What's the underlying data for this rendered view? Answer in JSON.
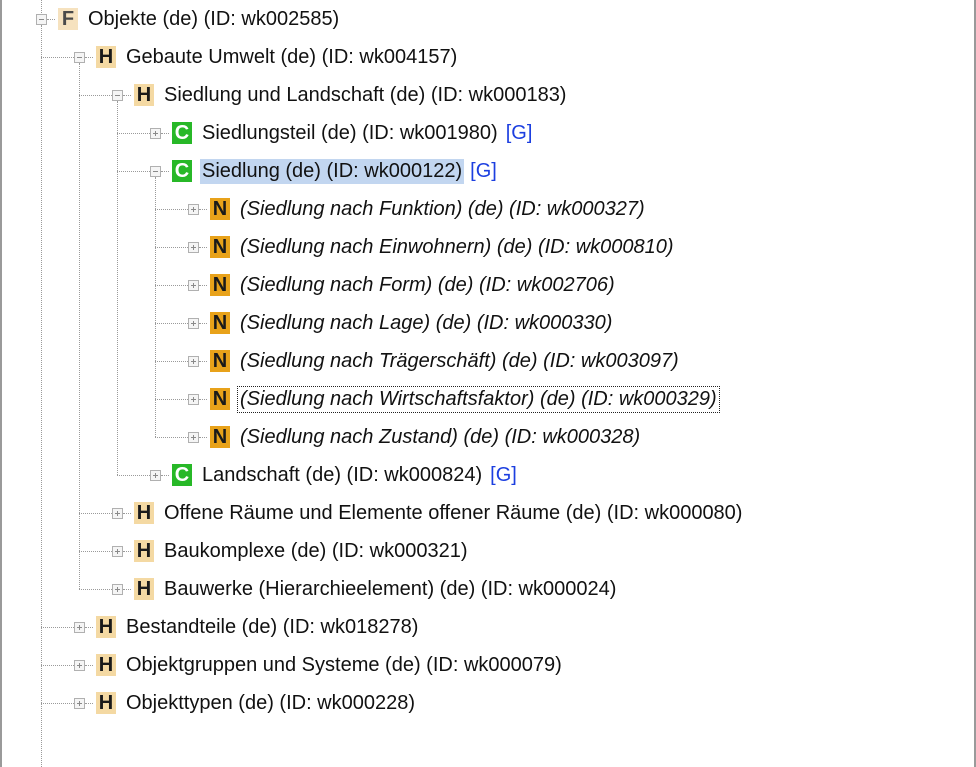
{
  "tree": {
    "nodes": [
      {
        "id": "objekte",
        "level": 0,
        "state": "expanded",
        "badge": "F",
        "label": "Objekte (de) (ID: wk002585)"
      },
      {
        "id": "gebaute-umwelt",
        "level": 1,
        "state": "expanded",
        "badge": "H",
        "label": "Gebaute Umwelt (de) (ID: wk004157)"
      },
      {
        "id": "siedlung-landschaft",
        "level": 2,
        "state": "expanded",
        "badge": "H",
        "label": "Siedlung und Landschaft (de) (ID: wk000183)"
      },
      {
        "id": "siedlungsteil",
        "level": 3,
        "state": "collapsed",
        "badge": "C",
        "label": "Siedlungsteil (de) (ID: wk001980)",
        "link": "[G]"
      },
      {
        "id": "siedlung",
        "level": 3,
        "state": "expanded",
        "badge": "C",
        "label": "Siedlung (de) (ID: wk000122)",
        "link": "[G]",
        "selected": true
      },
      {
        "id": "nach-funktion",
        "level": 4,
        "state": "collapsed",
        "badge": "N",
        "label": "(Siedlung nach Funktion) (de) (ID: wk000327)",
        "italic": true
      },
      {
        "id": "nach-einwohnern",
        "level": 4,
        "state": "collapsed",
        "badge": "N",
        "label": "(Siedlung nach Einwohnern) (de) (ID: wk000810)",
        "italic": true
      },
      {
        "id": "nach-form",
        "level": 4,
        "state": "collapsed",
        "badge": "N",
        "label": "(Siedlung nach Form) (de) (ID: wk002706)",
        "italic": true
      },
      {
        "id": "nach-lage",
        "level": 4,
        "state": "collapsed",
        "badge": "N",
        "label": "(Siedlung nach Lage) (de) (ID: wk000330)",
        "italic": true
      },
      {
        "id": "nach-traegerschaft",
        "level": 4,
        "state": "collapsed",
        "badge": "N",
        "label": "(Siedlung nach Trägerschäft) (de) (ID: wk003097)",
        "italic": true
      },
      {
        "id": "nach-wirtschaftsfaktor",
        "level": 4,
        "state": "collapsed",
        "badge": "N",
        "label": "(Siedlung nach Wirtschaftsfaktor) (de) (ID: wk000329)",
        "italic": true,
        "focused": true
      },
      {
        "id": "nach-zustand",
        "level": 4,
        "state": "collapsed",
        "badge": "N",
        "label": "(Siedlung nach Zustand) (de) (ID: wk000328)",
        "italic": true
      },
      {
        "id": "landschaft",
        "level": 3,
        "state": "collapsed",
        "badge": "C",
        "label": "Landschaft (de) (ID: wk000824)",
        "link": "[G]"
      },
      {
        "id": "offene-raeume",
        "level": 2,
        "state": "collapsed",
        "badge": "H",
        "label": "Offene Räume und Elemente offener Räume (de) (ID: wk000080)"
      },
      {
        "id": "baukomplexe",
        "level": 2,
        "state": "collapsed",
        "badge": "H",
        "label": "Baukomplexe (de) (ID: wk000321)"
      },
      {
        "id": "bauwerke",
        "level": 2,
        "state": "collapsed",
        "badge": "H",
        "label": "Bauwerke (Hierarchieelement) (de) (ID: wk000024)"
      },
      {
        "id": "bestandteile",
        "level": 1,
        "state": "collapsed",
        "badge": "H",
        "label": "Bestandteile (de) (ID: wk018278)"
      },
      {
        "id": "objektgruppen",
        "level": 1,
        "state": "collapsed",
        "badge": "H",
        "label": "Objektgruppen und Systeme (de) (ID: wk000079)"
      },
      {
        "id": "objekttypen",
        "level": 1,
        "state": "collapsed",
        "badge": "H",
        "label": "Objekttypen (de) (ID: wk000228)"
      }
    ]
  }
}
